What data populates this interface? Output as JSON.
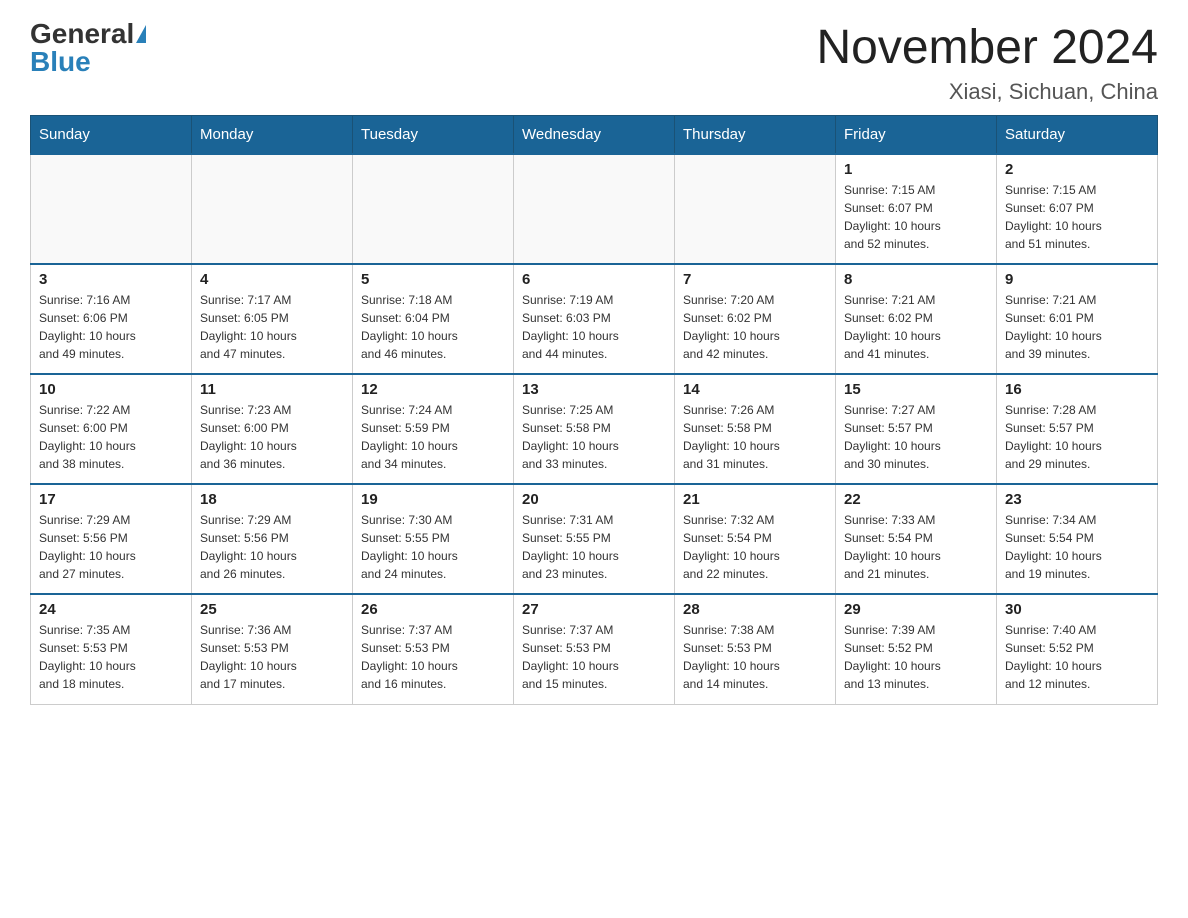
{
  "header": {
    "logo_general": "General",
    "logo_blue": "Blue",
    "month_title": "November 2024",
    "location": "Xiasi, Sichuan, China"
  },
  "weekdays": [
    "Sunday",
    "Monday",
    "Tuesday",
    "Wednesday",
    "Thursday",
    "Friday",
    "Saturday"
  ],
  "weeks": [
    [
      {
        "day": "",
        "info": ""
      },
      {
        "day": "",
        "info": ""
      },
      {
        "day": "",
        "info": ""
      },
      {
        "day": "",
        "info": ""
      },
      {
        "day": "",
        "info": ""
      },
      {
        "day": "1",
        "info": "Sunrise: 7:15 AM\nSunset: 6:07 PM\nDaylight: 10 hours\nand 52 minutes."
      },
      {
        "day": "2",
        "info": "Sunrise: 7:15 AM\nSunset: 6:07 PM\nDaylight: 10 hours\nand 51 minutes."
      }
    ],
    [
      {
        "day": "3",
        "info": "Sunrise: 7:16 AM\nSunset: 6:06 PM\nDaylight: 10 hours\nand 49 minutes."
      },
      {
        "day": "4",
        "info": "Sunrise: 7:17 AM\nSunset: 6:05 PM\nDaylight: 10 hours\nand 47 minutes."
      },
      {
        "day": "5",
        "info": "Sunrise: 7:18 AM\nSunset: 6:04 PM\nDaylight: 10 hours\nand 46 minutes."
      },
      {
        "day": "6",
        "info": "Sunrise: 7:19 AM\nSunset: 6:03 PM\nDaylight: 10 hours\nand 44 minutes."
      },
      {
        "day": "7",
        "info": "Sunrise: 7:20 AM\nSunset: 6:02 PM\nDaylight: 10 hours\nand 42 minutes."
      },
      {
        "day": "8",
        "info": "Sunrise: 7:21 AM\nSunset: 6:02 PM\nDaylight: 10 hours\nand 41 minutes."
      },
      {
        "day": "9",
        "info": "Sunrise: 7:21 AM\nSunset: 6:01 PM\nDaylight: 10 hours\nand 39 minutes."
      }
    ],
    [
      {
        "day": "10",
        "info": "Sunrise: 7:22 AM\nSunset: 6:00 PM\nDaylight: 10 hours\nand 38 minutes."
      },
      {
        "day": "11",
        "info": "Sunrise: 7:23 AM\nSunset: 6:00 PM\nDaylight: 10 hours\nand 36 minutes."
      },
      {
        "day": "12",
        "info": "Sunrise: 7:24 AM\nSunset: 5:59 PM\nDaylight: 10 hours\nand 34 minutes."
      },
      {
        "day": "13",
        "info": "Sunrise: 7:25 AM\nSunset: 5:58 PM\nDaylight: 10 hours\nand 33 minutes."
      },
      {
        "day": "14",
        "info": "Sunrise: 7:26 AM\nSunset: 5:58 PM\nDaylight: 10 hours\nand 31 minutes."
      },
      {
        "day": "15",
        "info": "Sunrise: 7:27 AM\nSunset: 5:57 PM\nDaylight: 10 hours\nand 30 minutes."
      },
      {
        "day": "16",
        "info": "Sunrise: 7:28 AM\nSunset: 5:57 PM\nDaylight: 10 hours\nand 29 minutes."
      }
    ],
    [
      {
        "day": "17",
        "info": "Sunrise: 7:29 AM\nSunset: 5:56 PM\nDaylight: 10 hours\nand 27 minutes."
      },
      {
        "day": "18",
        "info": "Sunrise: 7:29 AM\nSunset: 5:56 PM\nDaylight: 10 hours\nand 26 minutes."
      },
      {
        "day": "19",
        "info": "Sunrise: 7:30 AM\nSunset: 5:55 PM\nDaylight: 10 hours\nand 24 minutes."
      },
      {
        "day": "20",
        "info": "Sunrise: 7:31 AM\nSunset: 5:55 PM\nDaylight: 10 hours\nand 23 minutes."
      },
      {
        "day": "21",
        "info": "Sunrise: 7:32 AM\nSunset: 5:54 PM\nDaylight: 10 hours\nand 22 minutes."
      },
      {
        "day": "22",
        "info": "Sunrise: 7:33 AM\nSunset: 5:54 PM\nDaylight: 10 hours\nand 21 minutes."
      },
      {
        "day": "23",
        "info": "Sunrise: 7:34 AM\nSunset: 5:54 PM\nDaylight: 10 hours\nand 19 minutes."
      }
    ],
    [
      {
        "day": "24",
        "info": "Sunrise: 7:35 AM\nSunset: 5:53 PM\nDaylight: 10 hours\nand 18 minutes."
      },
      {
        "day": "25",
        "info": "Sunrise: 7:36 AM\nSunset: 5:53 PM\nDaylight: 10 hours\nand 17 minutes."
      },
      {
        "day": "26",
        "info": "Sunrise: 7:37 AM\nSunset: 5:53 PM\nDaylight: 10 hours\nand 16 minutes."
      },
      {
        "day": "27",
        "info": "Sunrise: 7:37 AM\nSunset: 5:53 PM\nDaylight: 10 hours\nand 15 minutes."
      },
      {
        "day": "28",
        "info": "Sunrise: 7:38 AM\nSunset: 5:53 PM\nDaylight: 10 hours\nand 14 minutes."
      },
      {
        "day": "29",
        "info": "Sunrise: 7:39 AM\nSunset: 5:52 PM\nDaylight: 10 hours\nand 13 minutes."
      },
      {
        "day": "30",
        "info": "Sunrise: 7:40 AM\nSunset: 5:52 PM\nDaylight: 10 hours\nand 12 minutes."
      }
    ]
  ]
}
